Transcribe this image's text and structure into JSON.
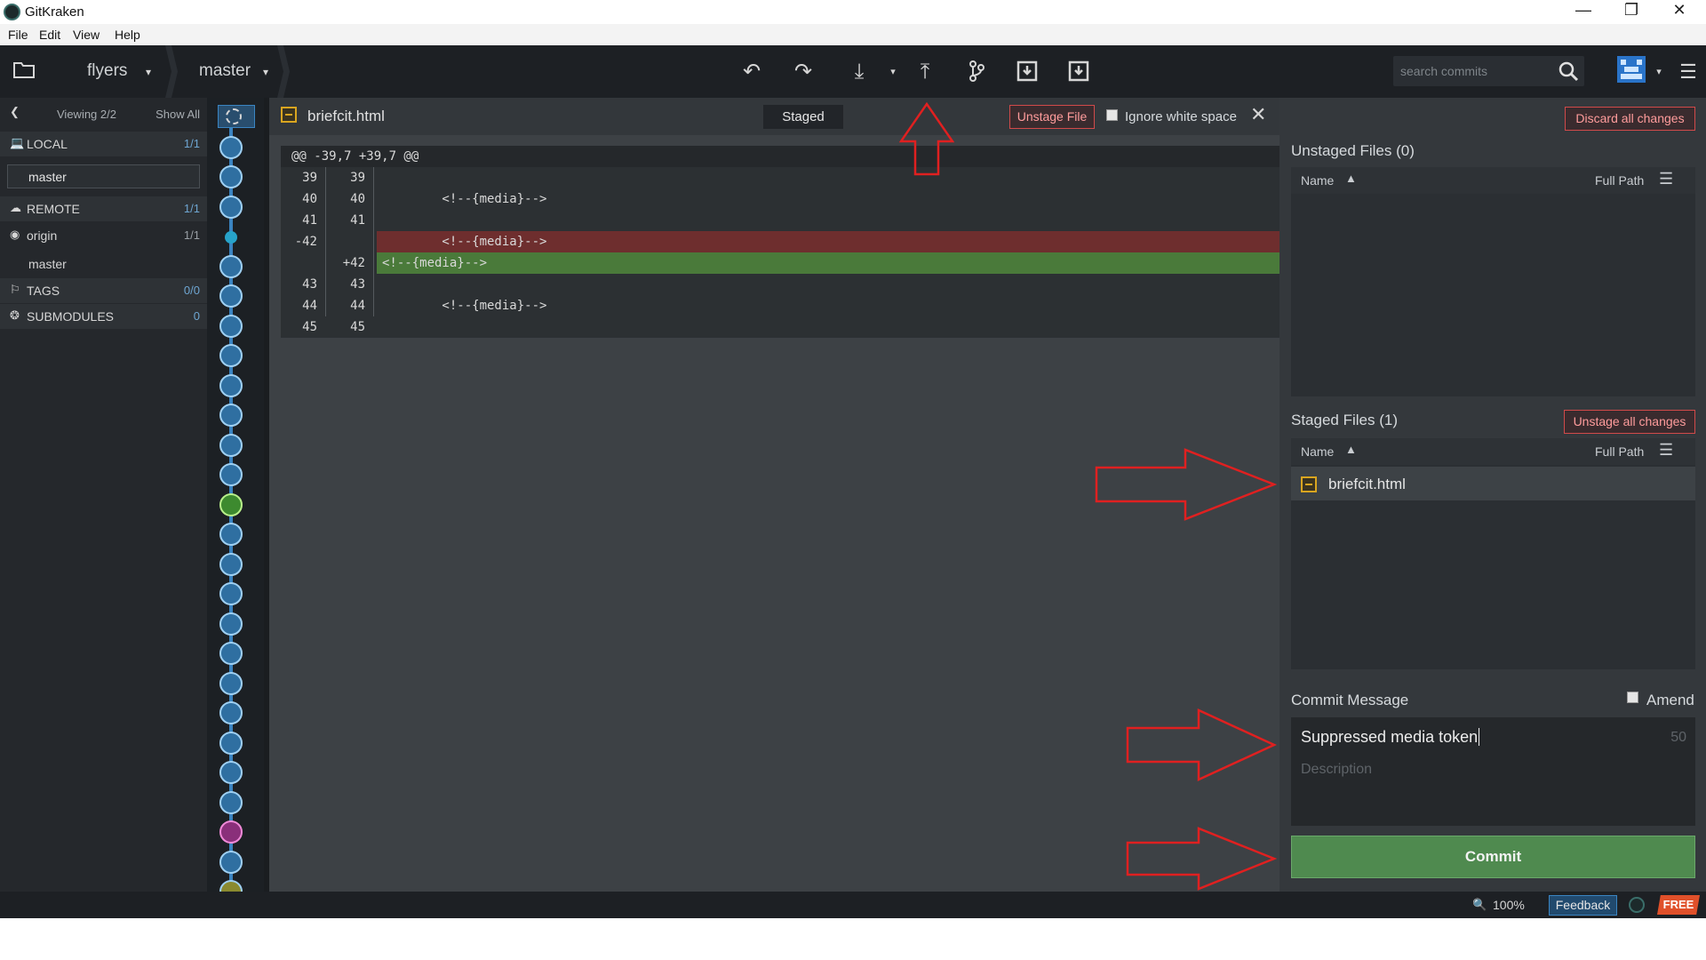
{
  "window": {
    "title": "GitKraken"
  },
  "menu": [
    "File",
    "Edit",
    "View",
    "Help"
  ],
  "toolbar": {
    "repo": "flyers",
    "branch": "master",
    "search_placeholder": "search commits",
    "icons": [
      "folder-icon",
      "undo-icon",
      "redo-icon",
      "pull-icon",
      "push-icon",
      "branch-icon",
      "stash-icon",
      "pop-icon",
      "search-icon",
      "profile-icon",
      "hamburger-icon"
    ]
  },
  "left_panel": {
    "viewing": "Viewing 2/2",
    "show_all": "Show All",
    "local": {
      "label": "LOCAL",
      "count": "1/1"
    },
    "local_branch": "master",
    "remote": {
      "label": "REMOTE",
      "count": "1/1"
    },
    "origin": {
      "label": "origin",
      "count": "1/1"
    },
    "origin_branch": "master",
    "tags": {
      "label": "TAGS",
      "count": "0/0"
    },
    "submodules": {
      "label": "SUBMODULES",
      "count": "0"
    }
  },
  "diff": {
    "filename": "briefcit.html",
    "staged_label": "Staged",
    "unstage_file": "Unstage File",
    "ignore_whitespace": "Ignore white space",
    "hunk_header": "@@ -39,7 +39,7 @@",
    "lines": [
      {
        "old": "39",
        "new": "39",
        "code": "",
        "type": "ctx"
      },
      {
        "old": "40",
        "new": "40",
        "code": "        <!--{media}-->",
        "type": "ctx"
      },
      {
        "old": "41",
        "new": "41",
        "code": "",
        "type": "ctx"
      },
      {
        "old": "-42",
        "new": "",
        "code": "        <!--{media}-->",
        "type": "del"
      },
      {
        "old": "",
        "new": "+42",
        "code": "<!--{media}-->",
        "type": "add"
      },
      {
        "old": "43",
        "new": "43",
        "code": "",
        "type": "ctx"
      },
      {
        "old": "44",
        "new": "44",
        "code": "        <!--{media}-->",
        "type": "ctx"
      },
      {
        "old": "45",
        "new": "45",
        "code": "",
        "type": "ctx"
      }
    ]
  },
  "right_panel": {
    "discard_all": "Discard all changes",
    "unstaged_title": "Unstaged Files (0)",
    "staged_title": "Staged Files (1)",
    "unstage_all": "Unstage all changes",
    "col_name": "Name",
    "col_full_path": "Full Path",
    "staged_files": [
      "briefcit.html"
    ],
    "commit_message_title": "Commit Message",
    "amend": "Amend",
    "summary_value": "Suppressed media token",
    "summary_counter": "50",
    "description_placeholder": "Description",
    "commit_button": "Commit"
  },
  "status_bar": {
    "zoom": "100%",
    "feedback": "Feedback",
    "plan": "FREE"
  },
  "colors": {
    "accent_blue": "#3a84c1",
    "delete_bg": "#6e2e2e",
    "add_bg": "#4a7a3a",
    "commit_green": "#4f8a4f",
    "annotation_red": "#e02020"
  }
}
